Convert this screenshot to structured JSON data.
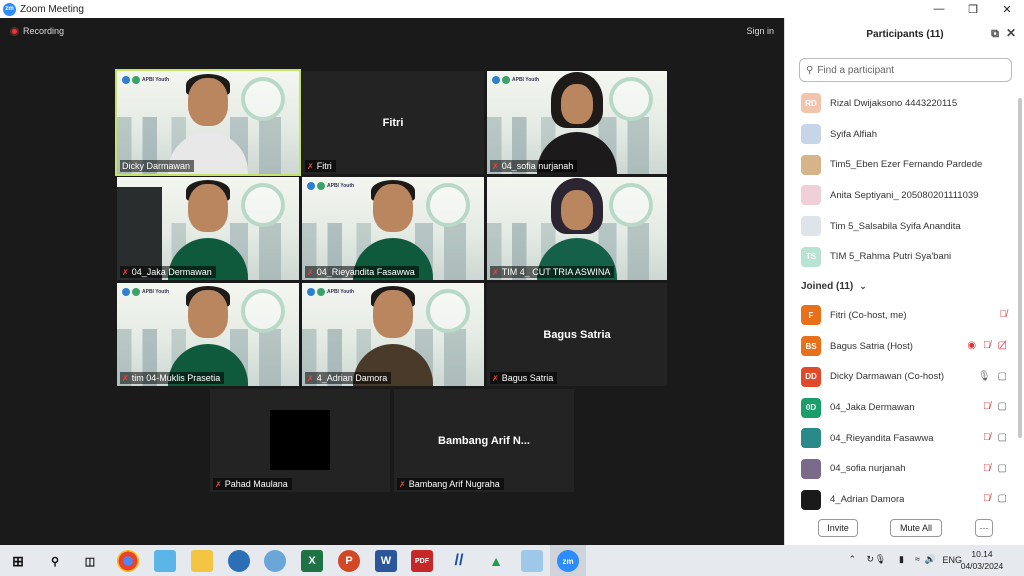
{
  "window": {
    "title": "Zoom Meeting",
    "controls": [
      "minimize",
      "maximize",
      "close"
    ]
  },
  "meeting": {
    "recording_label": "Recording",
    "signin_label": "Sign in",
    "tiles": [
      {
        "name": "Dicky Darmawan",
        "mic_muted": false,
        "type": "video"
      },
      {
        "name": "Fitri",
        "mic_muted": true,
        "type": "name_only",
        "center_label": "Fitri"
      },
      {
        "name": "04_sofia nurjanah",
        "mic_muted": true,
        "type": "video"
      },
      {
        "name": "04_Jaka Dermawan",
        "mic_muted": true,
        "type": "video"
      },
      {
        "name": "04_Rieyandita Fasawwa",
        "mic_muted": true,
        "type": "video"
      },
      {
        "name": "TIM 4_ CUT TRIA ASWINA",
        "mic_muted": true,
        "type": "video"
      },
      {
        "name": "tim 04-Muklis Prasetia",
        "mic_muted": true,
        "type": "video"
      },
      {
        "name": "4_Adrian Damora",
        "mic_muted": true,
        "type": "video"
      },
      {
        "name": "Bagus Satria",
        "mic_muted": true,
        "type": "name_only",
        "center_label": "Bagus Satria"
      },
      {
        "name": "Pahad Maulana",
        "mic_muted": true,
        "type": "black"
      },
      {
        "name": "Bambang Arif Nugraha",
        "mic_muted": true,
        "type": "name_only",
        "center_label": "Bambang Arif N..."
      }
    ],
    "logo_text": "APBI Youth"
  },
  "participants_panel": {
    "title": "Participants (11)",
    "search_placeholder": "Find a participant",
    "waiting": [
      {
        "name": "Rizal Dwijaksono 4443220115",
        "initials": "RD",
        "color": "#f3c4ad"
      },
      {
        "name": "Syifa Alfiah",
        "initials": "",
        "color": "#c8d4e8"
      },
      {
        "name": "Tim5_Eben Ezer Fernando Pardede",
        "initials": "",
        "color": "#d6b48a"
      },
      {
        "name": "Anita Septiyani_ 205080201111039",
        "initials": "",
        "color": "#f0d0d8"
      },
      {
        "name": "Tim 5_Salsabila Syifa Anandita",
        "initials": "",
        "color": "#dfe3ea"
      },
      {
        "name": "TIM 5_Rahma Putri Sya'bani",
        "initials": "TS",
        "color": "#b8e2d2"
      }
    ],
    "joined_label": "Joined (11)",
    "joined": [
      {
        "name": "Fitri (Co-host, me)",
        "initials": "F",
        "color": "#e8701a",
        "icons": [
          "mic-muted"
        ]
      },
      {
        "name": "Bagus Satria (Host)",
        "initials": "BS",
        "color": "#e8701a",
        "icons": [
          "record",
          "mic-muted",
          "video-off"
        ]
      },
      {
        "name": "Dicky Darmawan (Co-host)",
        "initials": "DD",
        "color": "#e04a2a",
        "icons": [
          "mic-on",
          "video-on"
        ]
      },
      {
        "name": "04_Jaka Dermawan",
        "initials": "0D",
        "color": "#1a9f6a",
        "icons": [
          "mic-muted",
          "video-on"
        ]
      },
      {
        "name": "04_Rieyandita Fasawwa",
        "initials": "",
        "color": "#2a8a8a",
        "icons": [
          "mic-muted",
          "video-on"
        ]
      },
      {
        "name": "04_sofia nurjanah",
        "initials": "",
        "color": "#7a6a8a",
        "icons": [
          "mic-muted",
          "video-on"
        ]
      },
      {
        "name": "4_Adrian Damora",
        "initials": "",
        "color": "#1a1a1a",
        "icons": [
          "mic-muted",
          "video-on"
        ]
      }
    ],
    "footer": {
      "invite": "Invite",
      "mute_all": "Mute All",
      "more": "···"
    }
  },
  "taskbar": {
    "apps": [
      "windows-start",
      "search",
      "task-view",
      "chrome",
      "notes",
      "file-explorer",
      "app-blue",
      "app-globe",
      "excel",
      "powerpoint",
      "word",
      "pdf",
      "app-slash",
      "app-green",
      "notepad",
      "zoom"
    ],
    "tray_language": "ENG",
    "time": "10.14",
    "date": "04/03/2024"
  }
}
